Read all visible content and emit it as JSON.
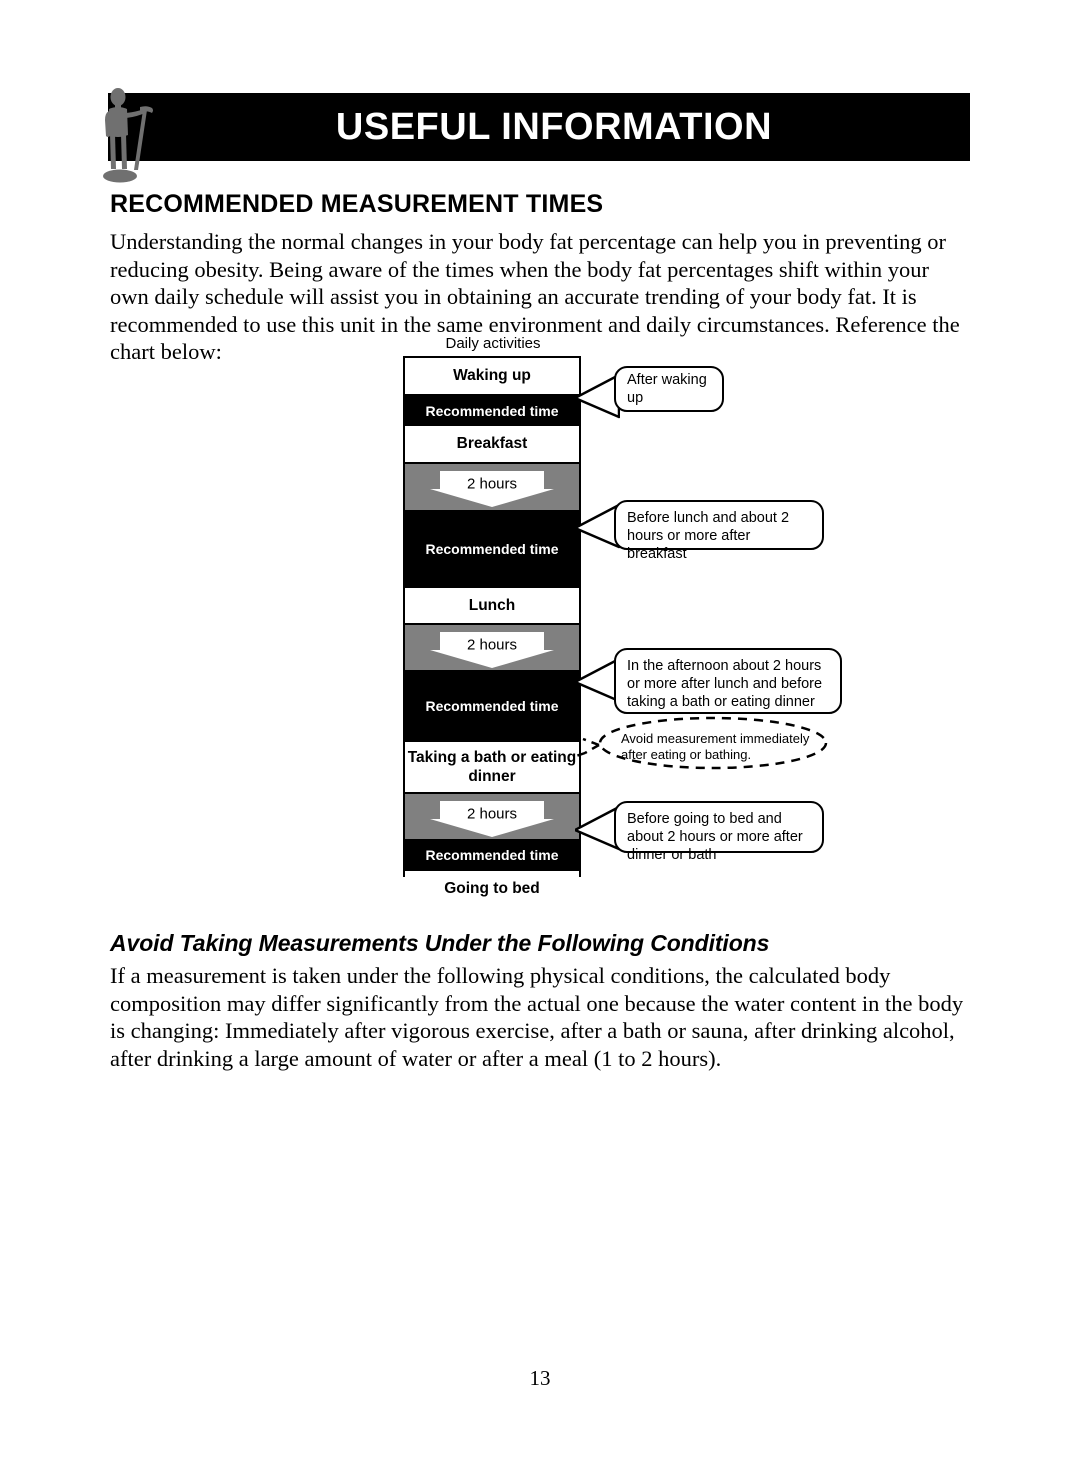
{
  "header": {
    "title": "USEFUL INFORMATION",
    "icon": "person-on-scale-icon"
  },
  "section": {
    "heading": "RECOMMENDED MEASUREMENT TIMES",
    "intro": "Understanding the normal changes in your body fat percentage can help you in preventing or reducing obesity. Being aware of the times when the body fat percentages shift within your own daily schedule will assist you in obtaining an accurate trending of your body fat. It is recommended to use this unit in the same environment and daily circumstances. Reference the chart below:"
  },
  "chart_data": {
    "type": "table",
    "title": "Daily activities",
    "bands": [
      {
        "kind": "activity",
        "label": "Waking up"
      },
      {
        "kind": "recommended",
        "label": "Recommended time"
      },
      {
        "kind": "activity",
        "label": "Breakfast"
      },
      {
        "kind": "gap",
        "label": "2 hours"
      },
      {
        "kind": "recommended",
        "label": "Recommended time"
      },
      {
        "kind": "activity",
        "label": "Lunch"
      },
      {
        "kind": "gap",
        "label": "2 hours"
      },
      {
        "kind": "recommended",
        "label": "Recommended time"
      },
      {
        "kind": "activity",
        "label": "Taking a bath or eating dinner"
      },
      {
        "kind": "gap",
        "label": "2 hours"
      },
      {
        "kind": "recommended",
        "label": "Recommended time"
      },
      {
        "kind": "activity",
        "label": "Going to bed"
      }
    ],
    "callouts": [
      {
        "id": "after-waking-up",
        "text": "After waking up"
      },
      {
        "id": "before-lunch",
        "text": "Before lunch and about 2 hours or more after breakfast"
      },
      {
        "id": "afternoon",
        "text": "In the afternoon about 2 hours or more after lunch and before taking a bath or eating dinner"
      },
      {
        "id": "before-bed",
        "text": "Before going to bed and about 2 hours or more after dinner or bath"
      }
    ],
    "warning_callout": {
      "id": "avoid-measurement",
      "line1": "Avoid measurement immediately",
      "line2": "after eating or bathing."
    },
    "colors": {
      "recommended_band": "#000000",
      "gap_band": "#808080",
      "activity_band": "#ffffff"
    }
  },
  "subsection": {
    "heading": "Avoid Taking Measurements Under the Following Conditions",
    "body": "If a measurement is taken under the following physical conditions, the calculated body composition may differ significantly from the actual one because the water content in the body is changing: Immediately after vigorous exercise, after a bath or sauna, after drinking alcohol, after drinking a large amount of water or after a meal (1 to 2 hours)."
  },
  "footer": {
    "page_number": "13"
  }
}
